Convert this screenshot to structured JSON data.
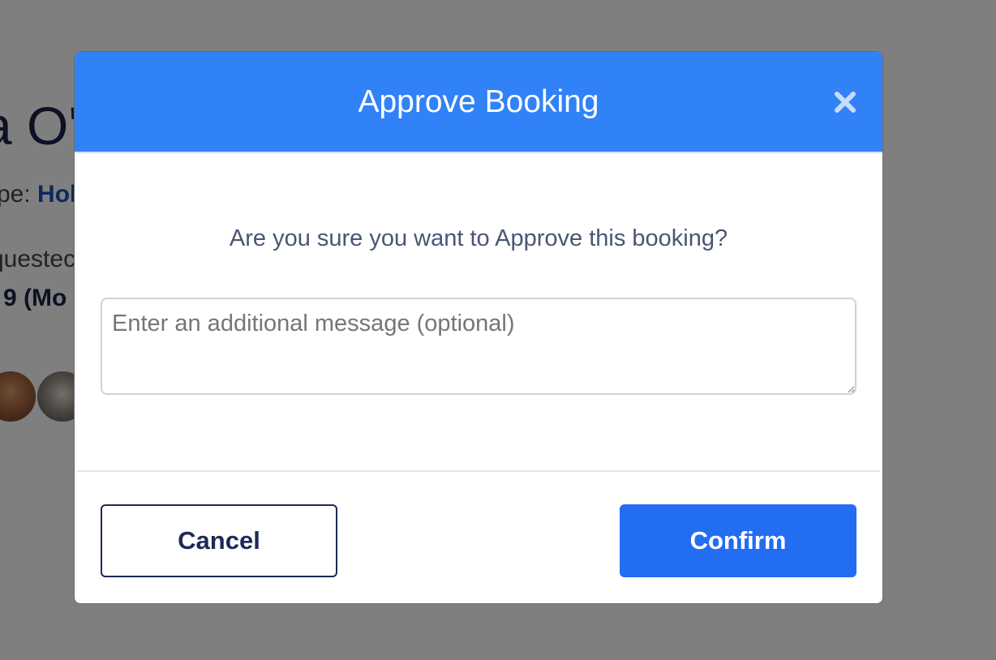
{
  "background_page": {
    "title_fragment": "a O'",
    "type_label": "pe: ",
    "type_value": "Hol",
    "requested_fragment": "questec",
    "date_fragment": "9 (Mo"
  },
  "modal": {
    "title": "Approve Booking",
    "close_icon": "close-icon",
    "question": "Are you sure you want to Approve this booking?",
    "message_placeholder": "Enter an additional message (optional)",
    "message_value": "",
    "cancel_label": "Cancel",
    "confirm_label": "Confirm"
  },
  "colors": {
    "header_bg": "#3182f6",
    "confirm_bg": "#236df3",
    "cancel_border": "#1e2a55",
    "overlay": "rgba(0,0,0,0.5)"
  }
}
